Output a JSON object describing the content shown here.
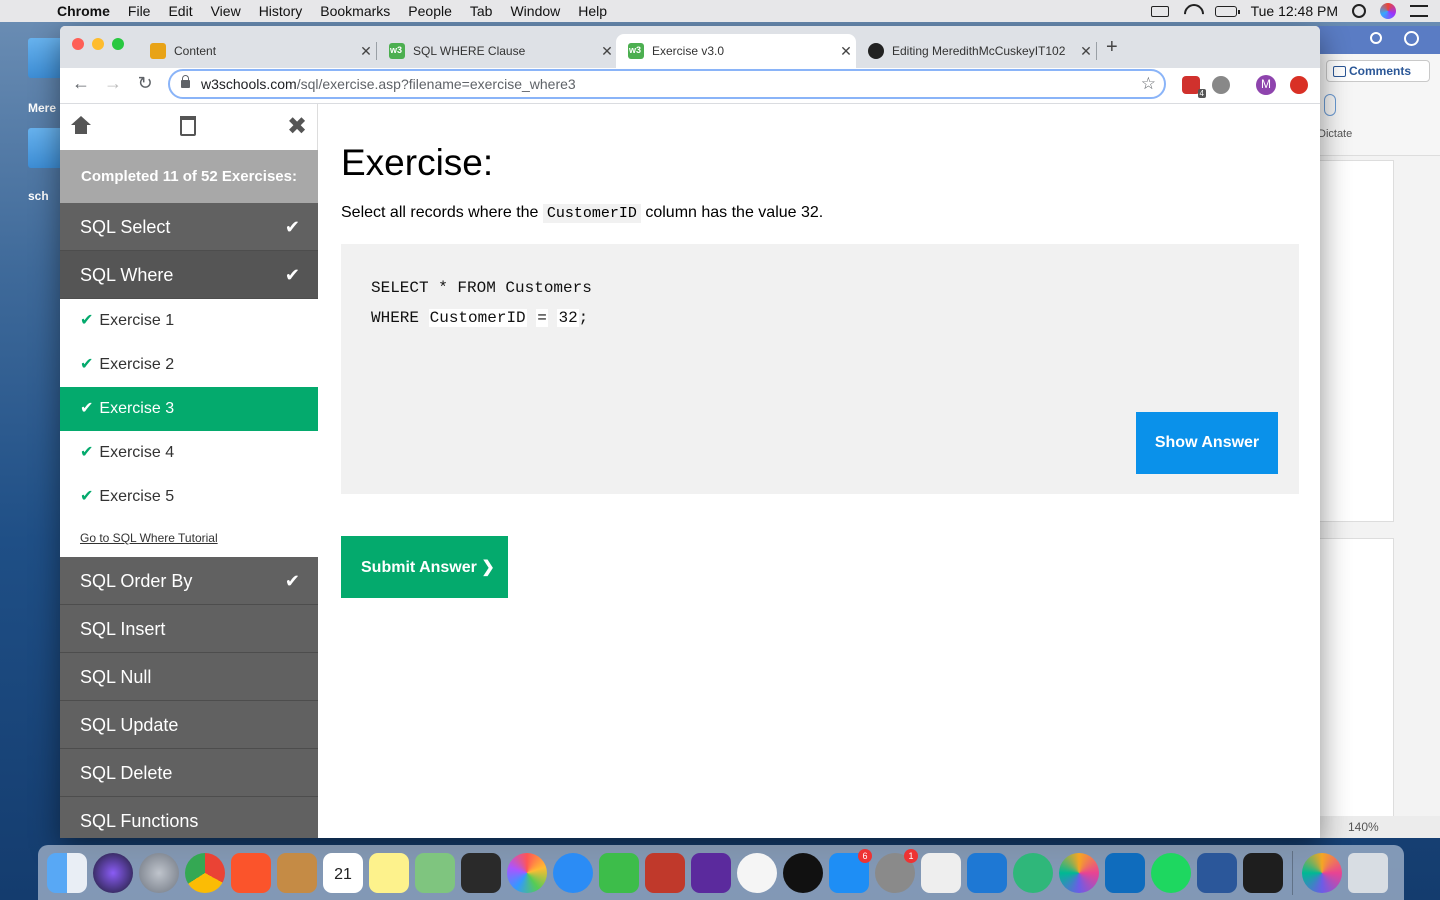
{
  "menubar": {
    "app": "Chrome",
    "items": [
      "File",
      "Edit",
      "View",
      "History",
      "Bookmarks",
      "People",
      "Tab",
      "Window",
      "Help"
    ],
    "clock": "Tue 12:48 PM"
  },
  "desktop": {
    "labels": [
      "Mere",
      "sch"
    ]
  },
  "browser": {
    "tabs": [
      {
        "title": "Content",
        "icon": "pencil-icon"
      },
      {
        "title": "SQL WHERE Clause",
        "icon": "w3schools-icon"
      },
      {
        "title": "Exercise v3.0",
        "icon": "w3schools-icon",
        "active": true
      },
      {
        "title": "Editing MeredithMcCuskeyIT102",
        "icon": "github-icon"
      }
    ],
    "url_host": "w3schools.com",
    "url_path": "/sql/exercise.asp?filename=exercise_where3",
    "avatar_letter": "M",
    "ext_badge": "4"
  },
  "sidebar": {
    "progress": "Completed 11 of 52 Exercises:",
    "categories_before": [
      {
        "label": "SQL Select",
        "done": true
      },
      {
        "label": "SQL Where",
        "done": true
      }
    ],
    "exercises": [
      "Exercise 1",
      "Exercise 2",
      "Exercise 3",
      "Exercise 4",
      "Exercise 5"
    ],
    "active_exercise": "Exercise 3",
    "tutorial_link": "Go to SQL Where Tutorial",
    "categories_after": [
      {
        "label": "SQL Order By",
        "done": true
      },
      {
        "label": "SQL Insert",
        "done": false
      },
      {
        "label": "SQL Null",
        "done": false
      },
      {
        "label": "SQL Update",
        "done": false
      },
      {
        "label": "SQL Delete",
        "done": false
      },
      {
        "label": "SQL Functions",
        "done": false
      }
    ]
  },
  "exercise": {
    "heading": "Exercise:",
    "desc_before": "Select all records where the ",
    "desc_code": "CustomerID",
    "desc_after": " column has the value 32.",
    "line1": "SELECT * FROM Customers",
    "line2_kw": "WHERE",
    "line2_field": "CustomerID",
    "line2_op": "=",
    "line2_val": "32",
    "line2_end": ";",
    "show_answer": "Show Answer",
    "submit": "Submit Answer ❯"
  },
  "word": {
    "comments": "Comments",
    "dictate": "Dictate",
    "zoom": "140%"
  },
  "dock": {
    "calendar_month": "JUL",
    "calendar_day": "21",
    "badges": {
      "appstore": "6",
      "settings": "1"
    }
  },
  "colors": {
    "w3_green": "#04aa6d",
    "show_answer_blue": "#0a91ea",
    "sidebar_gray": "#616161"
  }
}
